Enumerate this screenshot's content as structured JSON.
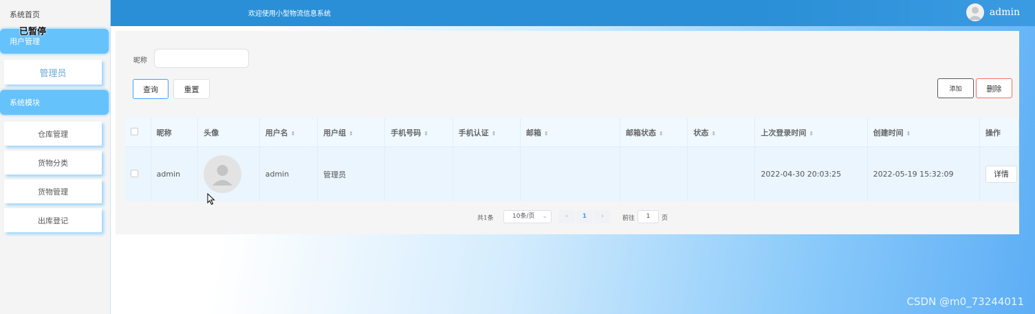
{
  "sidebar": {
    "home": "系统首页",
    "paused": "已暂停",
    "section1": "用户管理",
    "section1_items": [
      "管理员"
    ],
    "section2": "系统模块",
    "section2_items": [
      "仓库管理",
      "货物分类",
      "货物管理",
      "出库登记"
    ]
  },
  "header": {
    "welcome": "欢迎使用小型物流信息系统",
    "user": "admin",
    "avatar_icon": "user-avatar-icon"
  },
  "search": {
    "nick_label": "昵称",
    "nick_value": "",
    "query_label": "查询",
    "reset_label": "重置"
  },
  "actions": {
    "add_label": "添加",
    "delete_label": "删除"
  },
  "table": {
    "columns": [
      "昵称",
      "头像",
      "用户名",
      "用户组",
      "手机号码",
      "手机认证",
      "邮箱",
      "邮箱状态",
      "状态",
      "上次登录时间",
      "创建时间",
      "操作"
    ],
    "rows": [
      {
        "nickname": "admin",
        "avatar_icon": "user-avatar-icon",
        "username": "admin",
        "group": "管理员",
        "phone": "",
        "phone_verified": "",
        "email": "",
        "email_status": "",
        "status": "",
        "last_login": "2022-04-30 20:03:25",
        "created": "2022-05-19 15:32:09",
        "action_label": "详情"
      }
    ]
  },
  "pagination": {
    "total": "共1条",
    "page_size": "10条/页",
    "current_page": "1",
    "goto_label": "前往",
    "goto_value": "1",
    "page_suffix": "页"
  },
  "watermark": "CSDN @m0_73244011",
  "colors": {
    "topbar": "#2a8fd6",
    "sidebar_section": "#66c2fb",
    "primary": "#409eff",
    "danger": "#f56c6c"
  }
}
